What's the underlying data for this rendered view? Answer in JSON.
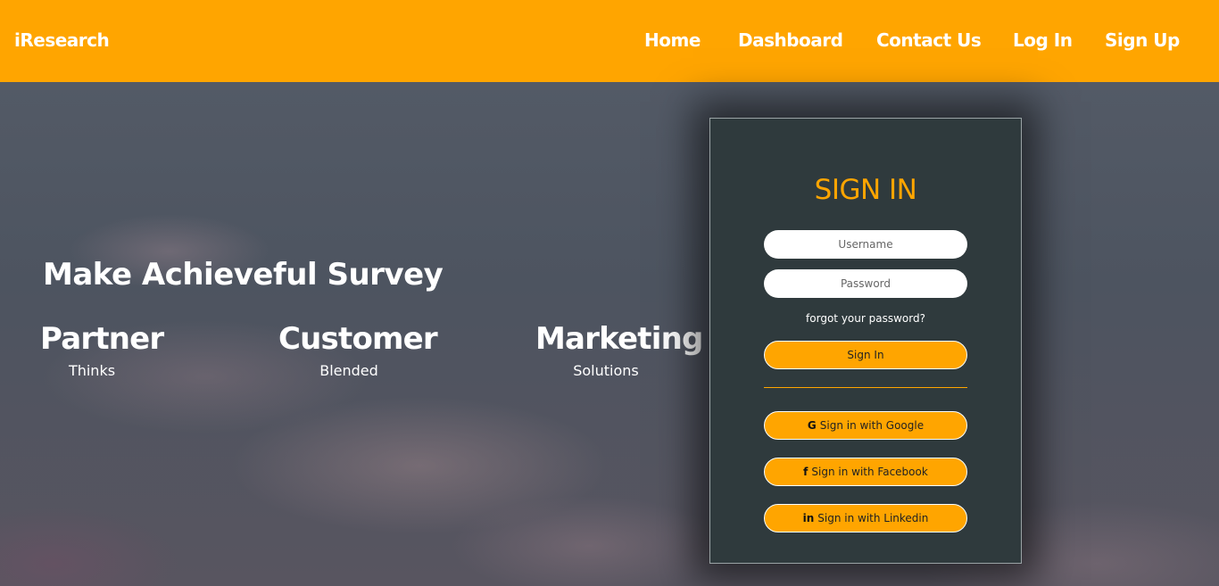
{
  "nav": {
    "brand": "iResearch",
    "links": [
      "Home",
      "Dashboard",
      "Contact Us",
      "Log In",
      "Sign Up"
    ]
  },
  "hero": {
    "title": "Make Achieveful Survey",
    "features": [
      {
        "title": "Partner",
        "subtitle": "Thinks"
      },
      {
        "title": "Customer",
        "subtitle": "Blended"
      },
      {
        "title": "Marketing",
        "subtitle": "Solutions"
      }
    ]
  },
  "signin": {
    "title": "SIGN IN",
    "username_placeholder": "Username",
    "password_placeholder": "Password",
    "forgot": "forgot your password?",
    "submit": "Sign In",
    "google": "Sign in with Google",
    "facebook": "Sign in with Facebook",
    "linkedin": "Sign in with Linkedin",
    "google_icon": "G",
    "facebook_icon": "f",
    "linkedin_icon": "in"
  },
  "colors": {
    "accent": "#ffa500",
    "card": "#2f3a3d"
  }
}
